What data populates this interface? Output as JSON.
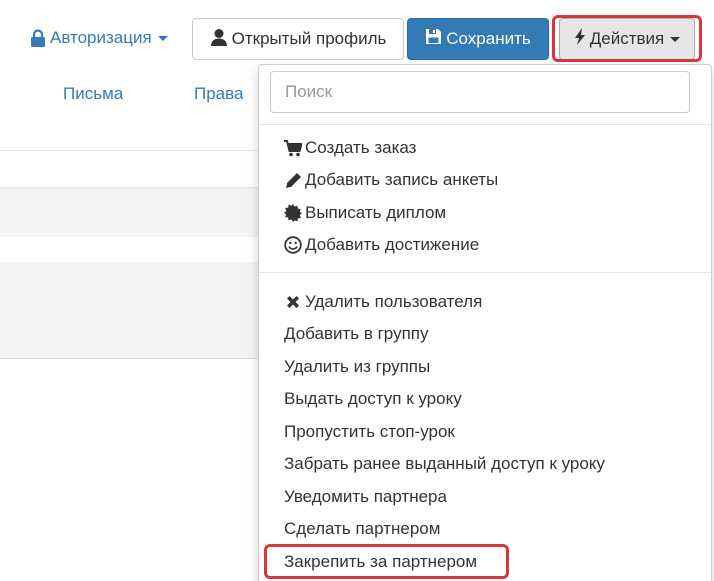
{
  "toolbar": {
    "auth_label": "Авторизация",
    "profile_label": "Открытый профиль",
    "save_label": "Сохранить",
    "actions_label": "Действия"
  },
  "tabs": [
    {
      "label": "Письма"
    },
    {
      "label": "Права"
    }
  ],
  "dropdown": {
    "search_placeholder": "Поиск",
    "group1": [
      {
        "label": "Создать заказ",
        "icon": "cart-icon"
      },
      {
        "label": "Добавить запись анкеты",
        "icon": "pencil-icon"
      },
      {
        "label": "Выписать диплом",
        "icon": "certificate-icon"
      },
      {
        "label": "Добавить достижение",
        "icon": "smile-icon"
      }
    ],
    "group2": [
      {
        "label": "Удалить пользователя",
        "icon": "remove-icon"
      },
      {
        "label": "Добавить в группу"
      },
      {
        "label": "Удалить из группы"
      },
      {
        "label": "Выдать доступ к уроку"
      },
      {
        "label": "Пропустить стоп-урок"
      },
      {
        "label": "Забрать ранее выданный доступ к уроку"
      },
      {
        "label": "Уведомить партнера"
      },
      {
        "label": "Сделать партнером"
      },
      {
        "label": "Закрепить за партнером"
      }
    ]
  },
  "colors": {
    "link": "#337ab7",
    "primary": "#337ab7",
    "highlight": "#d9363b"
  }
}
